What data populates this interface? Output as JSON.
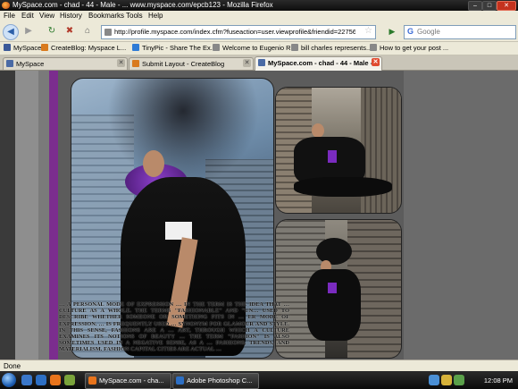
{
  "window": {
    "title": "MySpace.com - chad - 44 - Male - ... www.myspace.com/epcb123 - Mozilla Firefox",
    "min_label": "–",
    "max_label": "□",
    "close_label": "✕"
  },
  "menu": [
    "File",
    "Edit",
    "View",
    "History",
    "Bookmarks",
    "Tools",
    "Help"
  ],
  "nav": {
    "back_glyph": "◀",
    "forward_glyph": "▶",
    "reload_glyph": "↻",
    "stop_glyph": "✖",
    "home_glyph": "⌂",
    "url": "http://profile.myspace.com/index.cfm?fuseaction=user.viewprofile&friendid=227563910&MyToke",
    "go_glyph": "▶",
    "search_placeholder": "Google",
    "search_glyph": "G"
  },
  "bookmarks": [
    {
      "label": "MySpace",
      "icon": "myspace-icon",
      "color": "#3b5998"
    },
    {
      "label": "CreateBlog: Myspace L...",
      "icon": "createblog-icon",
      "color": "#d97a1e"
    },
    {
      "label": "TinyPic - Share The Ex...",
      "icon": "tinypic-icon",
      "color": "#2f7bd6"
    },
    {
      "label": "Welcome to Eugenio R...",
      "icon": "page-icon",
      "color": "#888888"
    },
    {
      "label": "bill charles represents...",
      "icon": "page-icon",
      "color": "#888888"
    },
    {
      "label": "How to get your post ...",
      "icon": "page-icon",
      "color": "#888888"
    }
  ],
  "tabs": [
    {
      "label": "MySpace",
      "active": false
    },
    {
      "label": "Submit Layout - CreateBlog",
      "active": false
    },
    {
      "label": "MySpace.com - chad - 44 - Male - ...",
      "active": true
    }
  ],
  "page": {
    "overlay_text": "… a personal mode of expression … in the term is the idea that … culture as a whole. The terms \"fashionable\" and \"un… used to describe whether someone or something fits in … er mode of expression. … is frequently used … synonym for glamour and style. In this sense, fashions are a … art, through which a culture examines its notions of beauty … the term \"fashion\" is also sometimes used in a negative sense, as a … fashions, trends, and materialism. Fashion capital cities are actual …"
  },
  "status": {
    "text": "Done"
  },
  "taskbar": {
    "buttons": [
      {
        "label": "MySpace.com - cha...",
        "icon": "firefox-icon",
        "color": "#e8741c"
      },
      {
        "label": "Adobe Photoshop C...",
        "icon": "photoshop-icon",
        "color": "#2d6fc4"
      }
    ],
    "clock": "12:08 PM"
  },
  "colors": {
    "accent_purple": "#7b2d8e",
    "close_red": "#e04a2f",
    "page_background": "#5c5c5c"
  }
}
